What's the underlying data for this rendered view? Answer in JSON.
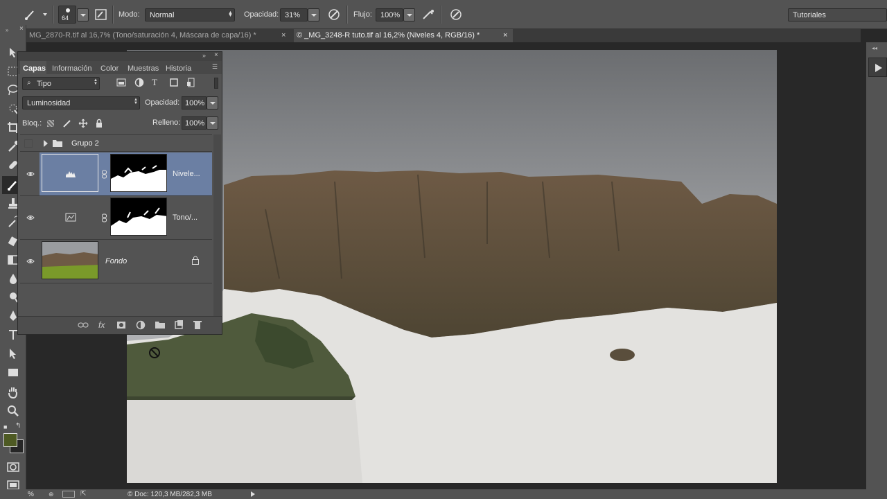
{
  "options_bar": {
    "brush_size": "64",
    "mode_label": "Modo:",
    "mode_value": "Normal",
    "opacity_label": "Opacidad:",
    "opacity_value": "31%",
    "flow_label": "Flujo:",
    "flow_value": "100%",
    "workspace": "Tutoriales"
  },
  "tabs": [
    {
      "label": "MG_2870-R.tif al 16,7% (Tono/saturación 4, Máscara de capa/16) *",
      "close": "×"
    },
    {
      "label": "© _MG_3248-R tuto.tif al 16,2% (Niveles 4, RGB/16) *",
      "close": "×"
    }
  ],
  "layers_panel": {
    "tabs": [
      "Capas",
      "Información",
      "Color",
      "Muestras",
      "Historia"
    ],
    "filter_label": "Tipo",
    "blend_mode": "Luminosidad",
    "opacity_label": "Opacidad:",
    "opacity_value": "100%",
    "lock_label": "Bloq.:",
    "fill_label": "Relleno:",
    "fill_value": "100%",
    "group_name": "Grupo 2",
    "layers": [
      {
        "name": "Nivele...",
        "type": "levels-adjustment",
        "selected": true
      },
      {
        "name": "Tono/...",
        "type": "hue-saturation-adjustment",
        "selected": false
      },
      {
        "name": "Fondo",
        "type": "background",
        "locked": true
      }
    ]
  },
  "status_bar": {
    "zoom": "%",
    "doc_info": "© Doc: 120,3 MB/282,3 MB"
  },
  "colors": {
    "ui_panel": "#535353",
    "ui_dark": "#282828",
    "selected_layer": "#6b7fa3",
    "foreground_swatch": "#4e5a23"
  }
}
